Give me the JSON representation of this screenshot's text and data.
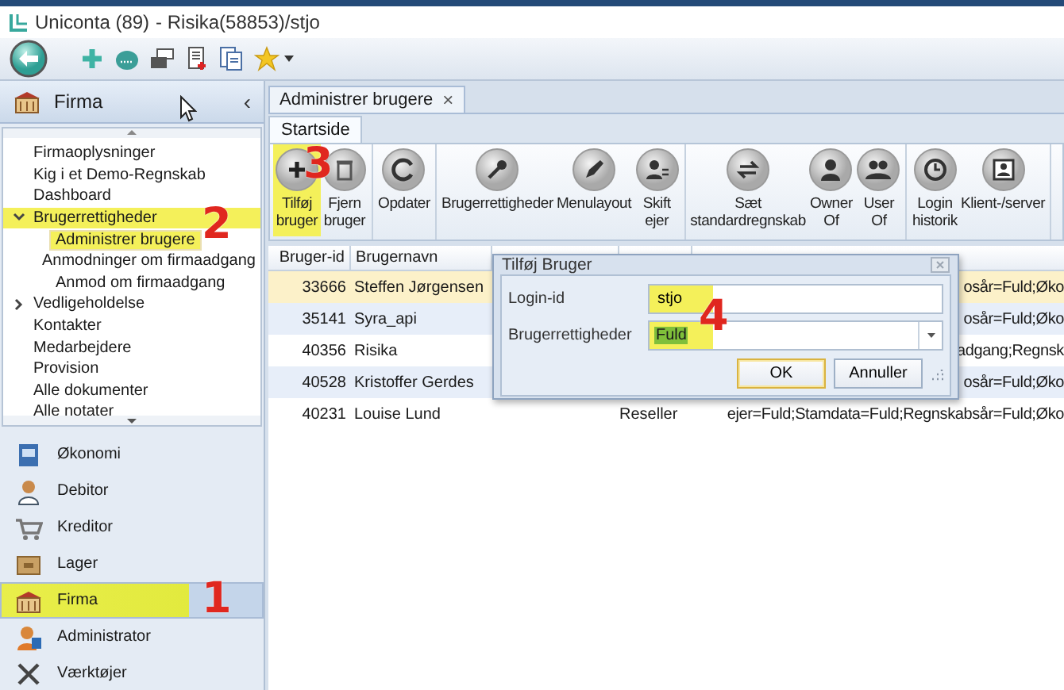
{
  "window": {
    "app": "Uniconta (89)",
    "context": "- Risika(58853)/stjo"
  },
  "sidebar": {
    "header": "Firma",
    "collapse": "‹",
    "tree": [
      {
        "label": "Firmaoplysninger",
        "selected": false,
        "highlighted": false
      },
      {
        "label": "Kig i et Demo-Regnskab",
        "selected": false,
        "highlighted": false
      },
      {
        "label": "Dashboard",
        "selected": false,
        "highlighted": false
      },
      {
        "label": "Brugerrettigheder",
        "selected": false,
        "highlighted": true,
        "expanded": true,
        "children": [
          {
            "label": "Administrer brugere",
            "selected": true,
            "highlighted": true
          },
          {
            "label": "Anmodninger om firmaadgang",
            "selected": false,
            "highlighted": false
          },
          {
            "label": "Anmod om firmaadgang",
            "selected": false,
            "highlighted": false
          }
        ]
      },
      {
        "label": "Vedligeholdelse",
        "selected": false,
        "highlighted": false,
        "expanded": false
      },
      {
        "label": "Kontakter",
        "selected": false,
        "highlighted": false
      },
      {
        "label": "Medarbejdere",
        "selected": false,
        "highlighted": false
      },
      {
        "label": "Provision",
        "selected": false,
        "highlighted": false
      },
      {
        "label": "Alle dokumenter",
        "selected": false,
        "highlighted": false
      },
      {
        "label": "Alle notater",
        "selected": false,
        "highlighted": false
      }
    ],
    "nav": [
      {
        "label": "Økonomi",
        "selected": false,
        "highlighted": false
      },
      {
        "label": "Debitor",
        "selected": false,
        "highlighted": false
      },
      {
        "label": "Kreditor",
        "selected": false,
        "highlighted": false
      },
      {
        "label": "Lager",
        "selected": false,
        "highlighted": false
      },
      {
        "label": "Firma",
        "selected": true,
        "highlighted": true
      },
      {
        "label": "Administrator",
        "selected": false,
        "highlighted": false
      },
      {
        "label": "Værktøjer",
        "selected": false,
        "highlighted": false
      }
    ]
  },
  "document_tab": {
    "label": "Administrer brugere",
    "close": "×"
  },
  "ribbon": {
    "tabs": [
      {
        "label": "Startside",
        "selected": true
      }
    ],
    "groups": [
      [
        {
          "label": "Tilføj\nbruger",
          "highlighted": true
        },
        {
          "label": "Fjern\nbruger",
          "highlighted": false
        }
      ],
      [
        {
          "label": "Opdater",
          "highlighted": false
        }
      ],
      [
        {
          "label": "Brugerrettigheder",
          "highlighted": false
        },
        {
          "label": "Menulayout",
          "highlighted": false
        },
        {
          "label": "Skift\nejer",
          "highlighted": false
        }
      ],
      [
        {
          "label": "Sæt\nstandardregnskab",
          "highlighted": false
        },
        {
          "label": "Owner\nOf",
          "highlighted": false
        },
        {
          "label": "User\nOf",
          "highlighted": false
        }
      ],
      [
        {
          "label": "Login\nhistorik",
          "highlighted": false
        },
        {
          "label": "Klient-/server",
          "highlighted": false
        }
      ]
    ]
  },
  "grid": {
    "columns": [
      "Bruger-id",
      "Brugernavn"
    ],
    "rows": [
      {
        "id": "33666",
        "name": "Steffen Jørgensen",
        "rights": "osår=Fuld;Øko",
        "selected": true
      },
      {
        "id": "35141",
        "name": "Syra_api",
        "rights": "osår=Fuld;Øko",
        "selected": false
      },
      {
        "id": "40356",
        "name": "Risika",
        "rights": "adgang;Regnsk",
        "selected": false
      },
      {
        "id": "40528",
        "name": "Kristoffer Gerdes",
        "rights": "osår=Fuld;Øko",
        "selected": false
      },
      {
        "id": "40231",
        "name": "Louise Lund",
        "role": "Reseller",
        "rights": "ejer=Fuld;Stamdata=Fuld;Regnskabsår=Fuld;Øko",
        "selected": false
      }
    ]
  },
  "dialog": {
    "title": "Tilføj Bruger",
    "fields": [
      {
        "kind": "text",
        "label": "Login-id",
        "value": "stjo",
        "highlighted": true
      },
      {
        "kind": "combo",
        "label": "Brugerrettigheder",
        "value": "Fuld",
        "highlighted": true
      }
    ],
    "buttons": [
      {
        "label": "OK",
        "default": true
      },
      {
        "label": "Annuller",
        "default": false
      }
    ]
  },
  "annotations": [
    {
      "text": "1"
    },
    {
      "text": "2"
    },
    {
      "text": "3"
    },
    {
      "text": "4"
    }
  ]
}
